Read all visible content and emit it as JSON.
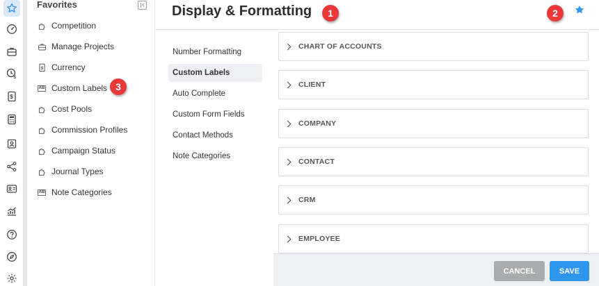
{
  "favorites": {
    "title": "Favorites",
    "items": [
      {
        "label": "Competition",
        "icon": "puzzle-icon"
      },
      {
        "label": "Manage Projects",
        "icon": "briefcase-icon"
      },
      {
        "label": "Currency",
        "icon": "dollar-doc-icon"
      },
      {
        "label": "Custom Labels",
        "icon": "ab-label-icon"
      },
      {
        "label": "Cost Pools",
        "icon": "puzzle-icon"
      },
      {
        "label": "Commission Profiles",
        "icon": "puzzle-icon"
      },
      {
        "label": "Campaign Status",
        "icon": "puzzle-icon"
      },
      {
        "label": "Journal Types",
        "icon": "puzzle-icon"
      },
      {
        "label": "Note Categories",
        "icon": "ab-label-icon"
      }
    ],
    "ab_text": "AB"
  },
  "header": {
    "title": "Display & Formatting"
  },
  "subnav": {
    "items": [
      {
        "label": "Number Formatting",
        "active": false
      },
      {
        "label": "Custom Labels",
        "active": true
      },
      {
        "label": "Auto Complete",
        "active": false
      },
      {
        "label": "Custom Form Fields",
        "active": false
      },
      {
        "label": "Contact Methods",
        "active": false
      },
      {
        "label": "Note Categories",
        "active": false
      }
    ]
  },
  "sections": [
    {
      "label": "CHART OF ACCOUNTS"
    },
    {
      "label": "CLIENT"
    },
    {
      "label": "COMPANY"
    },
    {
      "label": "CONTACT"
    },
    {
      "label": "CRM"
    },
    {
      "label": "EMPLOYEE"
    }
  ],
  "footer": {
    "cancel_label": "CANCEL",
    "save_label": "SAVE"
  },
  "callouts": [
    "1",
    "2",
    "3"
  ],
  "colors": {
    "accent": "#2f96ee",
    "callout": "#e8383a",
    "cancel": "#a9abad"
  }
}
